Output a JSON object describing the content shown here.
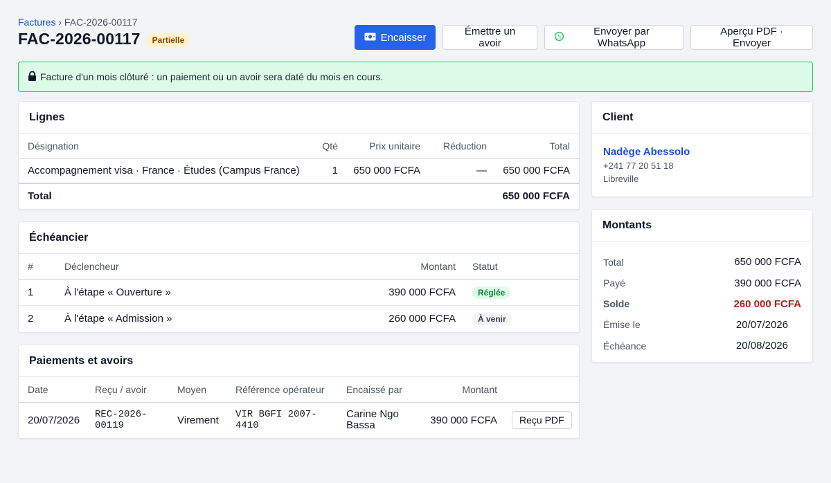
{
  "breadcrumb": {
    "parent": "Factures",
    "separator": "›",
    "current": "FAC-2026-00117"
  },
  "invoice": {
    "number": "FAC-2026-00117",
    "status": "Partielle"
  },
  "actions": {
    "encaisser": "Encaisser",
    "avoir": "Émettre un avoir",
    "whatsapp": "Envoyer par WhatsApp",
    "pdf": "Aperçu PDF · Envoyer"
  },
  "alert": {
    "text": "Facture d'un mois clôturé : un paiement ou un avoir sera daté du mois en cours."
  },
  "lignes": {
    "title": "Lignes",
    "headers": {
      "designation": "Désignation",
      "qte": "Qté",
      "prix": "Prix unitaire",
      "reduction": "Réduction",
      "total": "Total"
    },
    "rows": [
      {
        "designation": "Accompagnement visa · France · Études (Campus France)",
        "qte": "1",
        "prix": "650 000 FCFA",
        "reduction": "—",
        "total": "650 000 FCFA"
      }
    ],
    "footer": {
      "label": "Total",
      "value": "650 000 FCFA"
    }
  },
  "echeancier": {
    "title": "Échéancier",
    "headers": {
      "num": "#",
      "declencheur": "Déclencheur",
      "montant": "Montant",
      "statut": "Statut"
    },
    "rows": [
      {
        "num": "1",
        "declencheur": "À l'étape « Ouverture »",
        "montant": "390 000 FCFA",
        "statut": "Réglée"
      },
      {
        "num": "2",
        "declencheur": "À l'étape « Admission »",
        "montant": "260 000 FCFA",
        "statut": "À venir"
      }
    ]
  },
  "paiements": {
    "title": "Paiements et avoirs",
    "headers": {
      "date": "Date",
      "recu": "Reçu / avoir",
      "moyen": "Moyen",
      "reference": "Référence opérateur",
      "encaisse": "Encaissé par",
      "montant": "Montant"
    },
    "rows": [
      {
        "date": "20/07/2026",
        "recu": "REC-2026-00119",
        "moyen": "Virement",
        "reference": "VIR BGFI 2007-4410",
        "encaisse": "Carine Ngo Bassa",
        "montant": "390 000 FCFA",
        "action": "Reçu PDF"
      }
    ]
  },
  "client": {
    "title": "Client",
    "name": "Nadège Abessolo",
    "phone": "+241 77 20 51 18",
    "city": "Libreville"
  },
  "montants": {
    "title": "Montants",
    "total_label": "Total",
    "total": "650 000 FCFA",
    "paye_label": "Payé",
    "paye": "390 000 FCFA",
    "solde_label": "Solde",
    "solde": "260 000 FCFA",
    "emise_label": "Émise le",
    "emise": "20/07/2026",
    "echeance_label": "Échéance",
    "echeance": "20/08/2026"
  },
  "colors": {
    "primary": "#2563eb",
    "solde": "#b91c1c",
    "success_bg": "#dcfce7",
    "status_partial_bg": "#fef3c7",
    "whatsapp": "#22c55e"
  }
}
